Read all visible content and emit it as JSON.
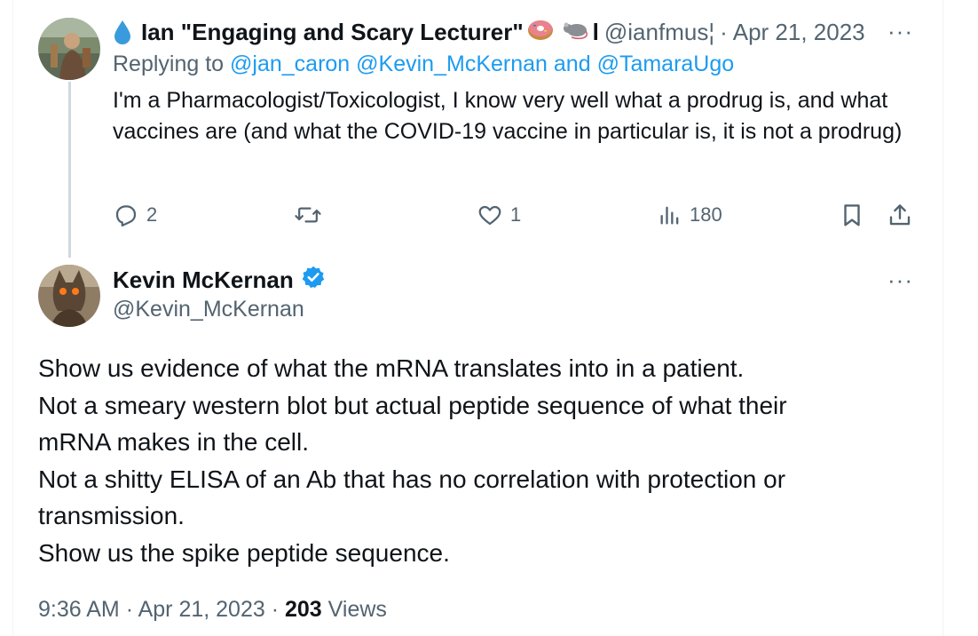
{
  "reply_tweet": {
    "display_name": "Ian \"Engaging and Scary Lecturer\"",
    "handle": "@ianfmus¦",
    "separator": "·",
    "date": "Apr 21, 2023",
    "more": "···",
    "replying_prefix": "Replying to",
    "mention_1": "@jan_caron",
    "mention_2": "@Kevin_McKernan",
    "mention_and": "and",
    "mention_3": "@TamaraUgo",
    "text": "I'm a Pharmacologist/Toxicologist, I know very well what a prodrug is, and what vaccines are (and what the COVID-19 vaccine in particular is, it is not a prodrug)",
    "actions": {
      "reply_count": "2",
      "retweet_count": "",
      "like_count": "1",
      "views_count": "180"
    },
    "icons": [
      "droplet-icon",
      "donut-icon",
      "rat-icon",
      "reply-icon",
      "retweet-icon",
      "like-icon",
      "views-icon",
      "bookmark-icon",
      "share-icon"
    ]
  },
  "main_tweet": {
    "display_name": "Kevin McKernan",
    "handle": "@Kevin_McKernan",
    "more": "···",
    "lines": [
      "Show us evidence of what the mRNA translates into in a patient.",
      "Not a smeary western blot but actual peptide sequence of what their",
      "mRNA makes in the cell.",
      "Not a shitty ELISA of an Ab that has no correlation with protection or",
      "transmission.",
      "Show us the spike peptide sequence."
    ],
    "time": "9:36 AM",
    "date": "Apr 21, 2023",
    "separator": "·",
    "views_count": "203",
    "views_label": "Views",
    "verified_color": "#1d9bf0"
  },
  "colors": {
    "accent": "#1d9bf0",
    "muted": "#536471",
    "text": "#0f1419",
    "thread_line": "#cfd9de"
  }
}
